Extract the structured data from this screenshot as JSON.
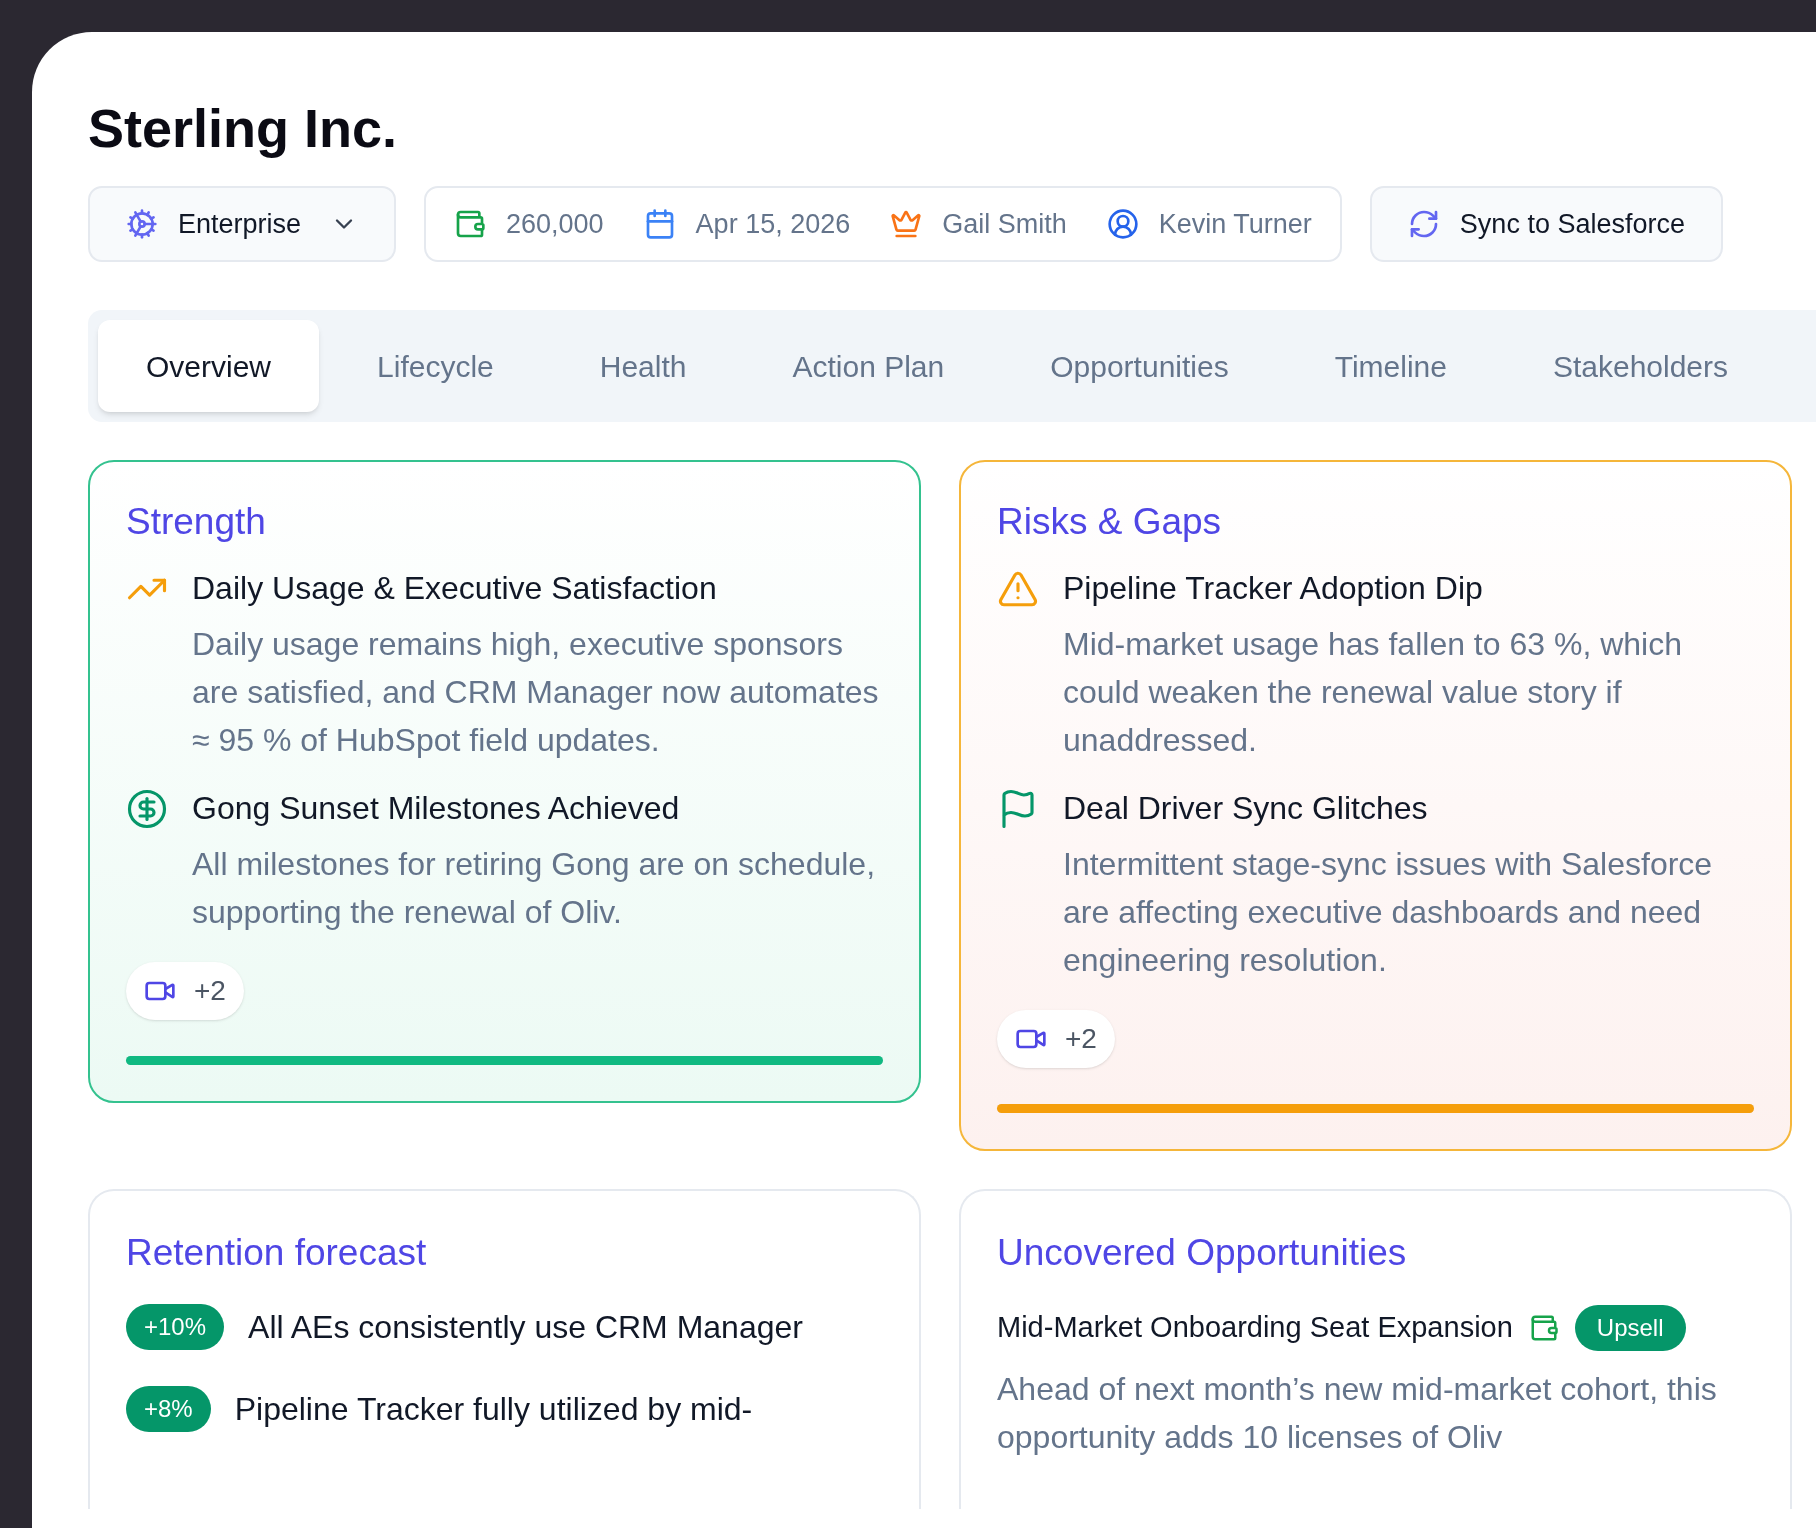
{
  "title": "Sterling Inc.",
  "segment": {
    "label": "Enterprise"
  },
  "meta": [
    {
      "kind": "amount",
      "text": "260,000"
    },
    {
      "kind": "date",
      "text": "Apr 15, 2026"
    },
    {
      "kind": "owner",
      "text": "Gail Smith"
    },
    {
      "kind": "contact",
      "text": "Kevin Turner"
    }
  ],
  "sync_button": "Sync to Salesforce",
  "tabs": [
    {
      "label": "Overview",
      "selected": true
    },
    {
      "label": "Lifecycle",
      "selected": false
    },
    {
      "label": "Health",
      "selected": false
    },
    {
      "label": "Action Plan",
      "selected": false
    },
    {
      "label": "Opportunities",
      "selected": false
    },
    {
      "label": "Timeline",
      "selected": false
    },
    {
      "label": "Stakeholders",
      "selected": false
    }
  ],
  "cards": [
    {
      "title": "Strength",
      "kind": "positive",
      "items": [
        {
          "kind": "trend",
          "title": "Daily Usage & Executive Satisfaction",
          "text": "Daily usage remains high, executive sponsors are satisfied, and CRM Manager now automates ≈ 95 % of HubSpot field updates."
        },
        {
          "kind": "dollar",
          "title": "Gong Sunset Milestones Achieved",
          "text": "All milestones for retiring Gong are on schedule, supporting the renewal of Oliv."
        }
      ],
      "sources": "+2",
      "level": 1
    },
    {
      "title": "Risks & Gaps",
      "kind": "risk",
      "items": [
        {
          "kind": "warning",
          "title": "Pipeline Tracker Adoption Dip",
          "text": "Mid-market usage has fallen to 63 %, which could weaken the renewal value story if unaddressed."
        },
        {
          "kind": "flag",
          "title": "Deal Driver Sync Glitches",
          "text": "Intermittent stage-sync issues with Salesforce are affecting executive dashboards and need engineering resolution."
        }
      ],
      "sources": "+2",
      "level": 1
    }
  ],
  "retention": {
    "title": "Retention forecast",
    "rows": [
      {
        "badge": "+10%",
        "text": "All AEs consistently use CRM Manager"
      },
      {
        "badge": "+8%",
        "text": "Pipeline Tracker fully utilized by mid-"
      }
    ]
  },
  "opportunities": {
    "title": "Uncovered Opportunities",
    "items": [
      {
        "title": "Mid-Market Onboarding Seat Expansion",
        "tag": "Upsell",
        "text": "Ahead of next month’s new mid-market cohort, this opportunity adds 10 licenses of Oliv"
      }
    ]
  }
}
